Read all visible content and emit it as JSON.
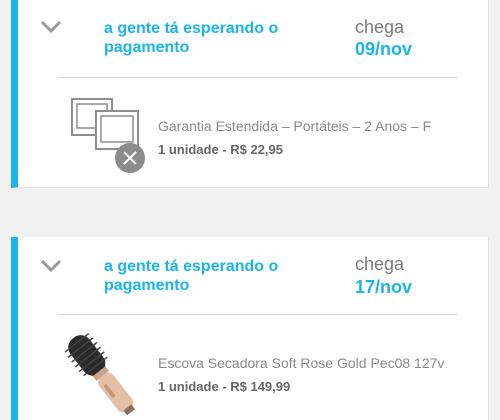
{
  "orders": [
    {
      "status": "a gente tá esperando o pagamento",
      "arrival_label": "chega",
      "arrival_date": "09/nov",
      "item": {
        "name": "Garantia Estendida – Portáteis – 2 Anos – F",
        "quantity_price": "1 unidade - R$ 22,95",
        "image_icon": "photos-placeholder-icon",
        "badge_icon": "close-icon"
      }
    },
    {
      "status": "a gente tá esperando o pagamento",
      "arrival_label": "chega",
      "arrival_date": "17/nov",
      "item": {
        "name": "Escova Secadora Soft Rose Gold Pec08 127v",
        "quantity_price": "1 unidade - R$ 149,99",
        "image_icon": "hair-dryer-brush-icon"
      }
    }
  ],
  "colors": {
    "accent": "#19b5ec",
    "muted_text": "#7a7a7a",
    "background": "#f1f1f1"
  }
}
